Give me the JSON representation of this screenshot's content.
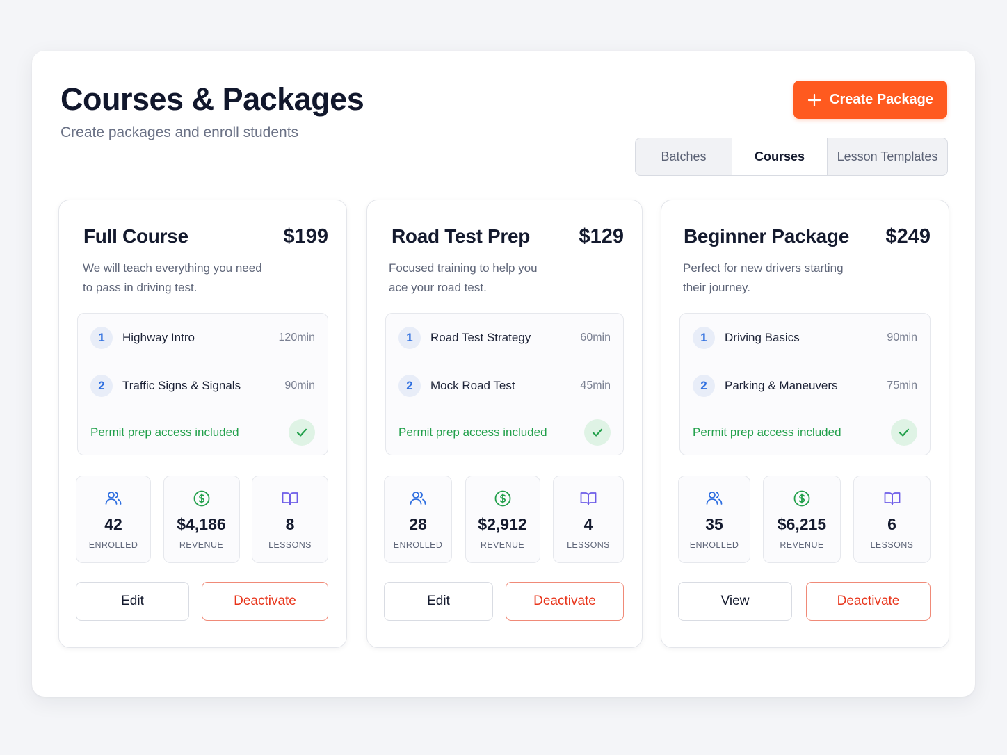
{
  "header": {
    "title": "Courses & Packages",
    "subtitle": "Create packages and enroll students",
    "create_button_label": "Create Package"
  },
  "tabs": [
    {
      "label": "Batches",
      "active": false
    },
    {
      "label": "Courses",
      "active": true
    },
    {
      "label": "Lesson Templates",
      "active": false
    }
  ],
  "colors": {
    "accent": "#ff5a1f",
    "success": "#22a04b",
    "danger": "#e8341a",
    "lesson_number": "#2f6fe0",
    "enrolled_icon": "#2f6fe0",
    "revenue_icon": "#22a04b",
    "lessons_icon": "#6d5ce8"
  },
  "cards": [
    {
      "title": "Full Course",
      "price": "$199",
      "description_line1": "We will teach everything you need",
      "description_line2": "to pass in driving test.",
      "lessons": [
        {
          "number": "1",
          "name": "Highway Intro",
          "duration": "120min"
        },
        {
          "number": "2",
          "name": "Traffic Signs & Signals",
          "duration": "90min"
        }
      ],
      "permit_text": "Permit prep access included",
      "stats": {
        "enrolled_value": "42",
        "enrolled_label": "ENROLLED",
        "enrolled_icon": "users-icon",
        "revenue_value": "$4,186",
        "revenue_label": "REVENUE",
        "revenue_icon": "dollar-circle-icon",
        "lessons_value": "8",
        "lessons_label": "LESSONS",
        "lessons_icon": "book-open-icon"
      },
      "primary_action": "Edit",
      "danger_action": "Deactivate"
    },
    {
      "title": "Road Test Prep",
      "price": "$129",
      "description_line1": "Focused training to help you",
      "description_line2": "ace your road test.",
      "lessons": [
        {
          "number": "1",
          "name": "Road Test Strategy",
          "duration": "60min"
        },
        {
          "number": "2",
          "name": "Mock Road Test",
          "duration": "45min"
        }
      ],
      "permit_text": "Permit prep access included",
      "stats": {
        "enrolled_value": "28",
        "enrolled_label": "ENROLLED",
        "enrolled_icon": "users-icon",
        "revenue_value": "$2,912",
        "revenue_label": "REVENUE",
        "revenue_icon": "dollar-circle-icon",
        "lessons_value": "4",
        "lessons_label": "LESSONS",
        "lessons_icon": "book-open-icon"
      },
      "primary_action": "Edit",
      "danger_action": "Deactivate"
    },
    {
      "title": "Beginner Package",
      "price": "$249",
      "description_line1": "Perfect for new drivers starting",
      "description_line2": "their journey.",
      "lessons": [
        {
          "number": "1",
          "name": "Driving Basics",
          "duration": "90min"
        },
        {
          "number": "2",
          "name": "Parking & Maneuvers",
          "duration": "75min"
        }
      ],
      "permit_text": "Permit prep access included",
      "stats": {
        "enrolled_value": "35",
        "enrolled_label": "ENROLLED",
        "enrolled_icon": "users-icon",
        "revenue_value": "$6,215",
        "revenue_label": "REVENUE",
        "revenue_icon": "dollar-circle-icon",
        "lessons_value": "6",
        "lessons_label": "LESSONS",
        "lessons_icon": "book-open-icon"
      },
      "primary_action": "View",
      "danger_action": "Deactivate"
    }
  ]
}
